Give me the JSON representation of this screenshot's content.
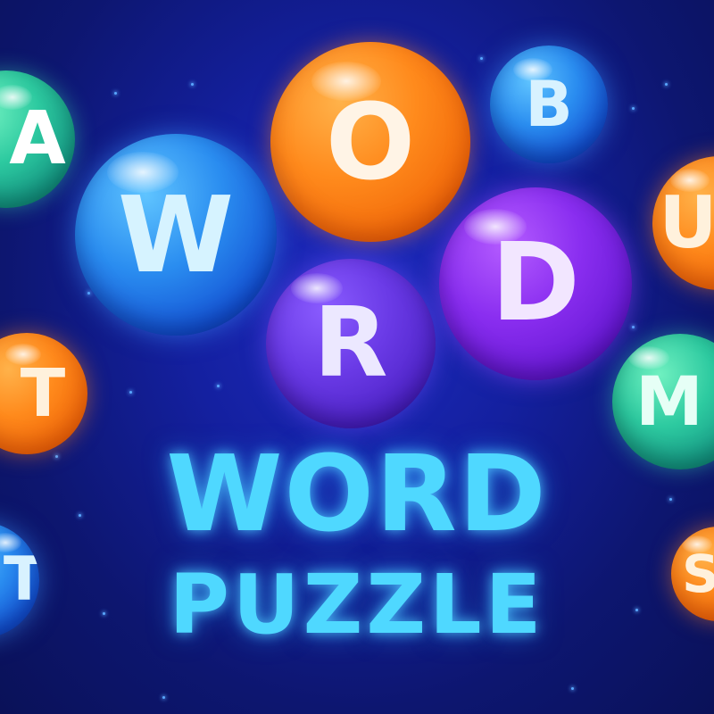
{
  "title": {
    "main": "WORD",
    "sub": "PUZZLE",
    "color": "#4fd8ff"
  },
  "bubbles": [
    {
      "letter": "A",
      "color": "teal"
    },
    {
      "letter": "O",
      "color": "orange"
    },
    {
      "letter": "B",
      "color": "blue"
    },
    {
      "letter": "W",
      "color": "blue"
    },
    {
      "letter": "U",
      "color": "orange"
    },
    {
      "letter": "D",
      "color": "purple"
    },
    {
      "letter": "R",
      "color": "violet"
    },
    {
      "letter": "T",
      "color": "orange"
    },
    {
      "letter": "M",
      "color": "teal"
    },
    {
      "letter": "T",
      "color": "blue"
    },
    {
      "letter": "S",
      "color": "orange"
    }
  ],
  "colors": {
    "background": "#1420a0",
    "orange": "#ff8a1c",
    "blue": "#2a8df0",
    "purple": "#8a2ef0",
    "teal": "#2dcaa0",
    "violet": "#6a3ae6"
  }
}
